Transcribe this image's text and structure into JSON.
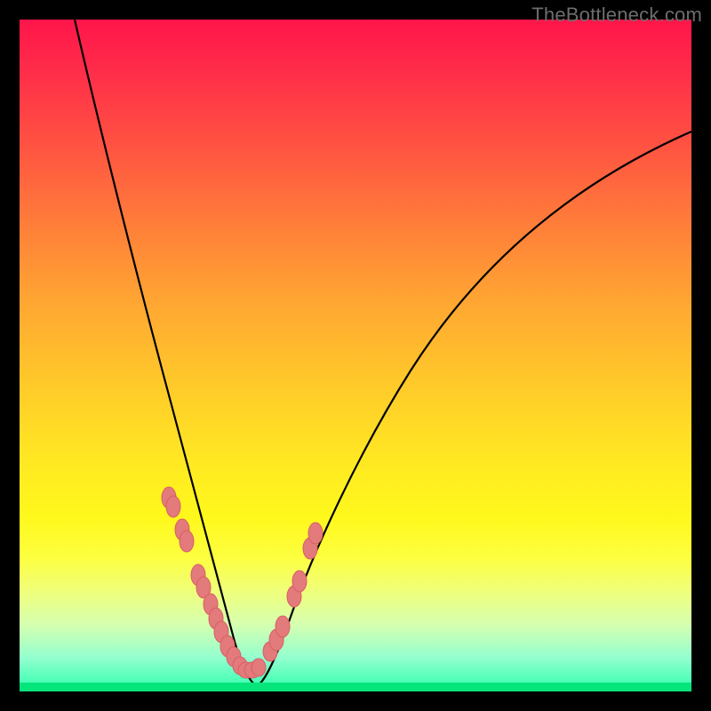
{
  "watermark": "TheBottleneck.com",
  "colors": {
    "frame_border": "#000000",
    "curve": "#000000",
    "dot_fill": "#e37a7c",
    "dot_stroke": "#d85f63",
    "green_base": "#05e57c"
  },
  "chart_data": {
    "type": "line",
    "title": "",
    "xlabel": "",
    "ylabel": "",
    "xlim": [
      0,
      100
    ],
    "ylim": [
      0,
      100
    ],
    "x": [
      8,
      12,
      16,
      20,
      23,
      26,
      28,
      30,
      31.5,
      33,
      34.5,
      36,
      38,
      40,
      42,
      45,
      50,
      56,
      63,
      72,
      82,
      92,
      100
    ],
    "values": [
      100,
      84,
      70,
      57,
      46,
      37,
      29,
      21,
      15,
      9,
      4,
      1,
      1,
      3,
      7,
      14,
      26,
      39,
      51,
      62,
      71,
      77,
      81
    ],
    "annotations_dots_x_pct": [
      22.3,
      22.9,
      24.2,
      24.9,
      26.6,
      27.4,
      28.4,
      29.2,
      30.1,
      31.0,
      31.9,
      32.8,
      33.7,
      34.7,
      35.6,
      37.3,
      38.2,
      39.2,
      40.8,
      41.7,
      43.2,
      44.0
    ],
    "annotations_dots_y_pct_from_top": [
      71.1,
      72.5,
      75.9,
      77.6,
      82.6,
      84.5,
      87.0,
      89.1,
      91.1,
      93.2,
      94.9,
      96.2,
      96.8,
      96.8,
      96.4,
      94.0,
      92.3,
      90.3,
      85.8,
      83.6,
      78.7,
      76.4
    ]
  }
}
